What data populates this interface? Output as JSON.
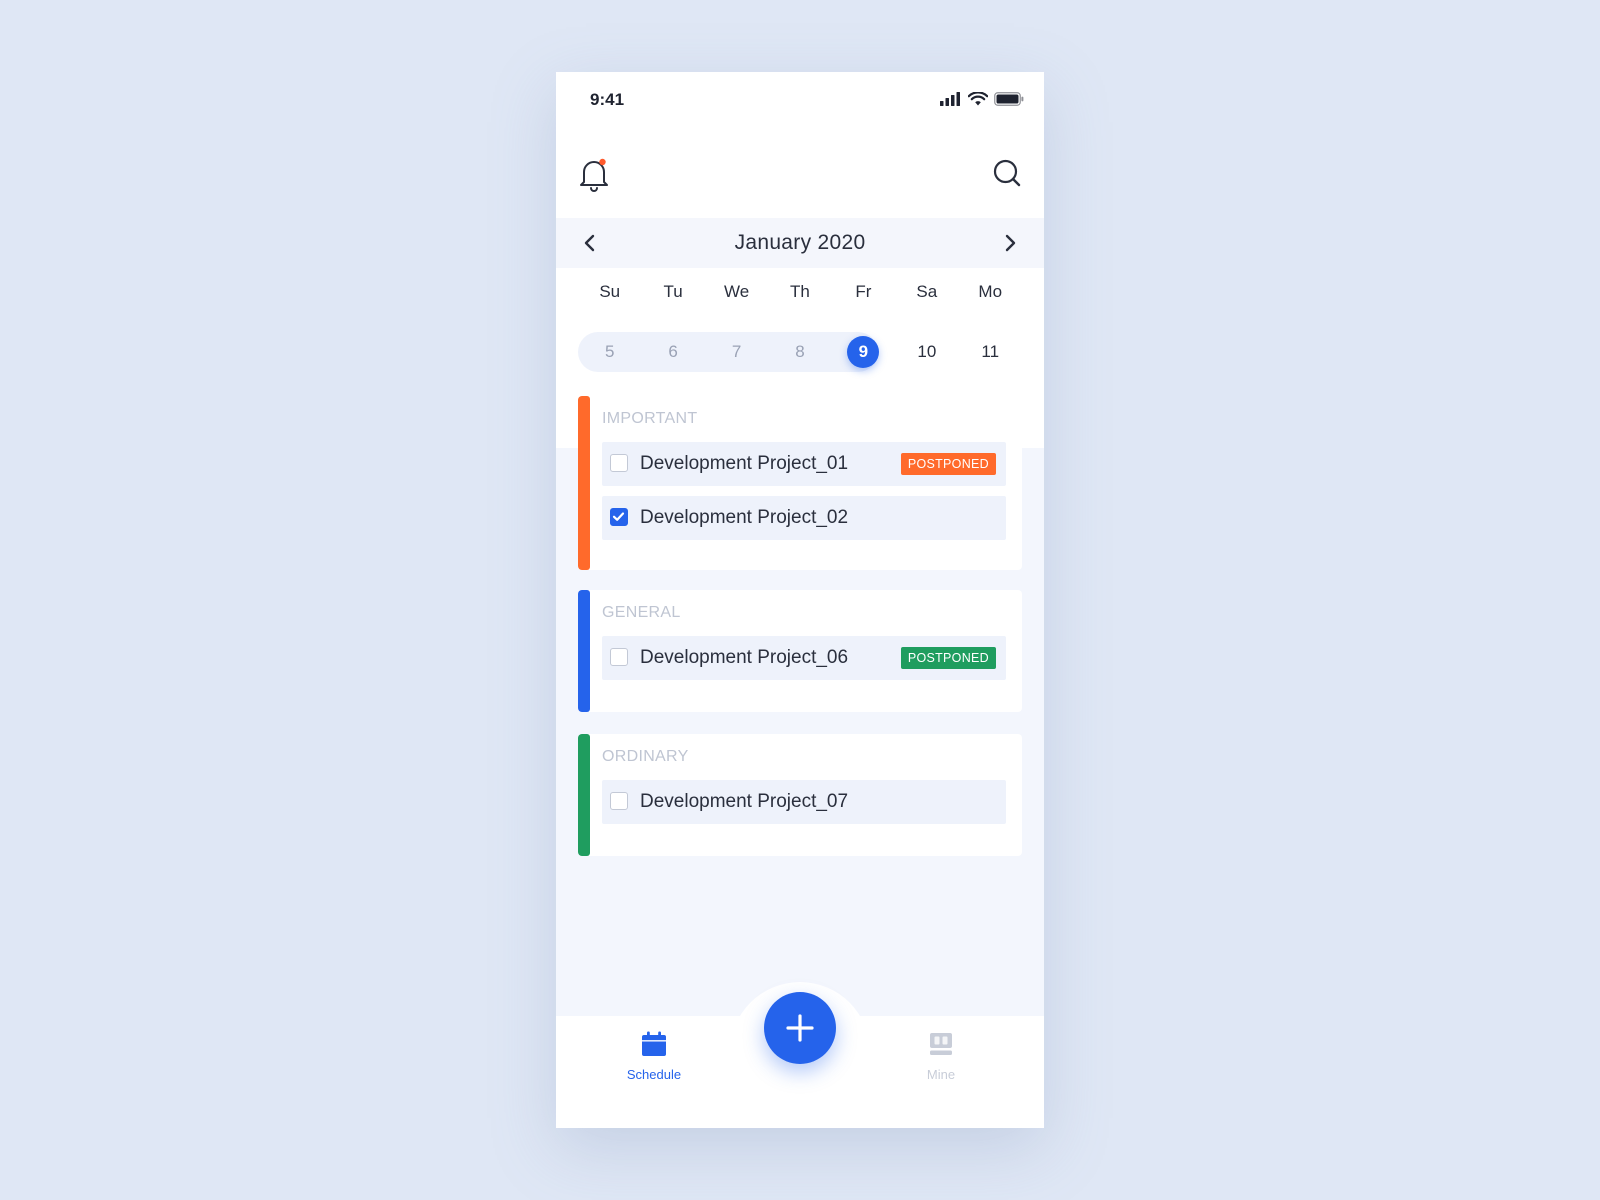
{
  "status_bar": {
    "time": "9:41",
    "icons": [
      "signal-icon",
      "wifi-icon",
      "battery-icon"
    ]
  },
  "header": {
    "icons": [
      "bell-icon",
      "search-icon"
    ],
    "notification_dot_color": "#ff5a2c"
  },
  "calendar": {
    "month_label": "January 2020",
    "weekdays": [
      "Su",
      "Tu",
      "We",
      "Th",
      "Fr",
      "Sa",
      "Mo"
    ],
    "days": [
      "5",
      "6",
      "7",
      "8",
      "9",
      "10",
      "11"
    ],
    "selected_day": "9"
  },
  "groups": [
    {
      "title": "IMPORTANT",
      "color": "#ff6a2b",
      "tasks": [
        {
          "label": "Development Project_01",
          "checked": false,
          "badge": "POSTPONED",
          "badge_color": "#ff6a2b"
        },
        {
          "label": "Development Project_02",
          "checked": true,
          "badge": "",
          "badge_color": ""
        }
      ]
    },
    {
      "title": "GENERAL",
      "color": "#2563eb",
      "tasks": [
        {
          "label": "Development Project_06",
          "checked": false,
          "badge": "POSTPONED",
          "badge_color": "#1f9d5f"
        }
      ]
    },
    {
      "title": "ORDINARY",
      "color": "#1f9d5f",
      "tasks": [
        {
          "label": "Development Project_07",
          "checked": false,
          "badge": "",
          "badge_color": ""
        }
      ]
    }
  ],
  "tabbar": {
    "schedule_label": "Schedule",
    "mine_label": "Mine",
    "active_color": "#2563eb",
    "inactive_color": "#c8cdd8"
  }
}
